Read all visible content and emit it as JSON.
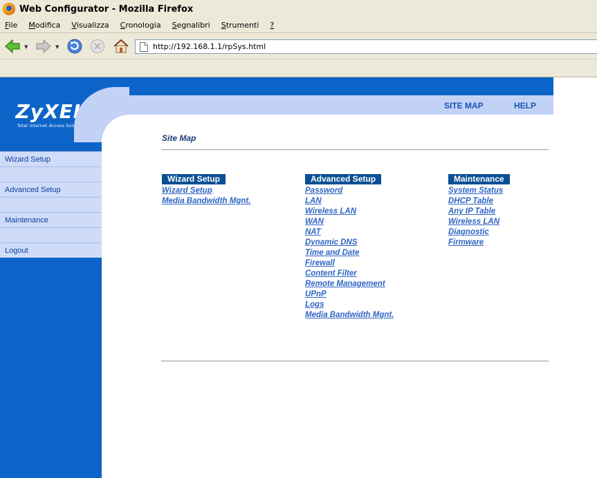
{
  "window": {
    "title": "Web Configurator - Mozilla Firefox"
  },
  "menubar": [
    {
      "label": "File",
      "u": "F",
      "rest": "ile"
    },
    {
      "label": "Modifica",
      "u": "M",
      "rest": "odifica"
    },
    {
      "label": "Visualizza",
      "u": "V",
      "rest": "isualizza"
    },
    {
      "label": "Cronologia",
      "u": "C",
      "rest": "ronologia"
    },
    {
      "label": "Segnalibri",
      "u": "S",
      "rest": "egnalibri"
    },
    {
      "label": "Strumenti",
      "u": "S",
      "rest": "trumenti"
    },
    {
      "label": "?",
      "u": "?",
      "rest": ""
    }
  ],
  "navbar": {
    "url": "http://192.168.1.1/rpSys.html"
  },
  "logo": {
    "brand": "ZyXEL",
    "tagline": "Total Internet Access Solution"
  },
  "sidebar": {
    "items": [
      {
        "label": "Wizard Setup"
      },
      {
        "label": "Advanced Setup"
      },
      {
        "label": "Maintenance"
      },
      {
        "label": "Logout"
      }
    ]
  },
  "header": {
    "site_map": "SITE MAP",
    "help": "HELP"
  },
  "main": {
    "title": "Site Map",
    "columns": [
      {
        "heading": "Wizard Setup",
        "links": [
          "Wizard Setup",
          "Media Bandwidth Mgnt."
        ]
      },
      {
        "heading": "Advanced Setup",
        "links": [
          "Password",
          "LAN",
          "Wireless LAN",
          "WAN",
          "NAT",
          "Dynamic DNS",
          "Time and Date",
          "Firewall",
          "Content Filter",
          "Remote Management",
          "UPnP",
          "Logs",
          "Media Bandwidth Mgnt."
        ]
      },
      {
        "heading": "Maintenance",
        "links": [
          "System Status",
          "DHCP Table",
          "Any IP Table",
          "Wireless LAN",
          "Diagnostic",
          "Firmware"
        ]
      }
    ]
  },
  "colors": {
    "sidebar_blue": "#0d64c8",
    "header_light": "#c2d2f6",
    "heading_bar": "#0b4f94",
    "link": "#2e65c4"
  }
}
